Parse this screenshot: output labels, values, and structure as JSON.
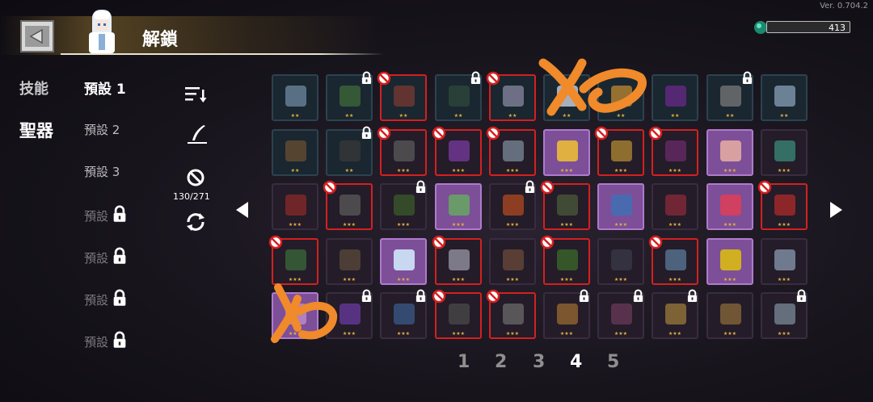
{
  "version": "Ver. 0.704.2",
  "header": {
    "title": "解鎖",
    "currency_amount": "413"
  },
  "tabs": [
    {
      "label": "技能",
      "active": false
    },
    {
      "label": "聖器",
      "active": true
    }
  ],
  "presets": [
    {
      "label": "預設 1",
      "state": "active"
    },
    {
      "label": "預設 2",
      "state": "normal"
    },
    {
      "label": "預設 3",
      "state": "normal"
    },
    {
      "label": "預設",
      "state": "locked"
    },
    {
      "label": "預設",
      "state": "locked"
    },
    {
      "label": "預設",
      "state": "locked"
    },
    {
      "label": "預設",
      "state": "locked"
    }
  ],
  "toolbar": {
    "counter": "130/271",
    "icons": [
      "sort-icon",
      "quill-icon",
      "ban-icon",
      "refresh-icon"
    ]
  },
  "grid": {
    "rows": [
      [
        {
          "tier": "r2",
          "stars": "★★",
          "badge": "",
          "color": "#6f8aa0"
        },
        {
          "tier": "r2",
          "stars": "★★",
          "badge": "lock",
          "color": "#3f6a3a"
        },
        {
          "tier": "r2",
          "stars": "★★",
          "badge": "ban",
          "color": "#7a3a33"
        },
        {
          "tier": "r2",
          "stars": "★★",
          "badge": "lock",
          "color": "#2d4a3a"
        },
        {
          "tier": "r2",
          "stars": "★★",
          "badge": "ban",
          "color": "#8a8aa0"
        },
        {
          "tier": "r2",
          "stars": "★★",
          "badge": "",
          "color": "#d8dde8"
        },
        {
          "tier": "r2",
          "stars": "★★",
          "badge": "",
          "color": "#c08a30"
        },
        {
          "tier": "r2",
          "stars": "★★",
          "badge": "",
          "color": "#6a2a8a"
        },
        {
          "tier": "r2",
          "stars": "★★",
          "badge": "lock",
          "color": "#7a7a78"
        },
        {
          "tier": "r2",
          "stars": "★★",
          "badge": "",
          "color": "#8aa0b8"
        }
      ],
      [
        {
          "tier": "r2",
          "stars": "★★",
          "badge": "",
          "color": "#6a5030"
        },
        {
          "tier": "r2",
          "stars": "★★",
          "badge": "lock",
          "color": "#3a3a3a"
        },
        {
          "tier": "r3",
          "stars": "★★★",
          "badge": "ban",
          "color": "#5a5a5a"
        },
        {
          "tier": "r3",
          "stars": "★★★",
          "badge": "ban",
          "color": "#7a3aa0"
        },
        {
          "tier": "r3",
          "stars": "★★★",
          "badge": "ban",
          "color": "#7a8a9a"
        },
        {
          "tier": "epic",
          "stars": "★★★",
          "badge": "",
          "color": "#e0b040"
        },
        {
          "tier": "r3",
          "stars": "★★★",
          "badge": "ban",
          "color": "#b08a30"
        },
        {
          "tier": "r3",
          "stars": "★★★",
          "badge": "ban",
          "color": "#6a2a6a"
        },
        {
          "tier": "epic",
          "stars": "★★★",
          "badge": "",
          "color": "#d8a0a0"
        },
        {
          "tier": "r3",
          "stars": "★★★",
          "badge": "",
          "color": "#3a8a7a"
        }
      ],
      [
        {
          "tier": "r3",
          "stars": "★★★",
          "badge": "",
          "color": "#8a2a2a"
        },
        {
          "tier": "r3",
          "stars": "★★★",
          "badge": "ban",
          "color": "#5a5a5a"
        },
        {
          "tier": "r3",
          "stars": "★★★",
          "badge": "lock",
          "color": "#3a5a2a"
        },
        {
          "tier": "epic",
          "stars": "★★★",
          "badge": "",
          "color": "#6a9a6a"
        },
        {
          "tier": "r3",
          "stars": "★★★",
          "badge": "lock",
          "color": "#b04a20"
        },
        {
          "tier": "r3",
          "stars": "★★★",
          "badge": "ban",
          "color": "#4a5a3a"
        },
        {
          "tier": "epic",
          "stars": "★★★",
          "badge": "",
          "color": "#4a6ab0"
        },
        {
          "tier": "r3",
          "stars": "★★★",
          "badge": "",
          "color": "#8a2a3a"
        },
        {
          "tier": "epic",
          "stars": "★★★",
          "badge": "",
          "color": "#d04060"
        },
        {
          "tier": "r3",
          "stars": "★★★",
          "badge": "ban",
          "color": "#b02a2a"
        }
      ],
      [
        {
          "tier": "r3",
          "stars": "★★★",
          "badge": "ban",
          "color": "#3a6a3a"
        },
        {
          "tier": "r3",
          "stars": "★★★",
          "badge": "",
          "color": "#5a4a3a"
        },
        {
          "tier": "epic",
          "stars": "★★★",
          "badge": "",
          "color": "#c8d8f0"
        },
        {
          "tier": "r3",
          "stars": "★★★",
          "badge": "ban",
          "color": "#9a9aa8"
        },
        {
          "tier": "r3",
          "stars": "★★★",
          "badge": "",
          "color": "#6a4a3a"
        },
        {
          "tier": "r3",
          "stars": "★★★",
          "badge": "ban",
          "color": "#3a6a2a"
        },
        {
          "tier": "r3",
          "stars": "★★★",
          "badge": "",
          "color": "#3a3a4a"
        },
        {
          "tier": "r3",
          "stars": "★★★",
          "badge": "ban",
          "color": "#5a7a9a"
        },
        {
          "tier": "epic",
          "stars": "★★★",
          "badge": "",
          "color": "#d0b020"
        },
        {
          "tier": "r3",
          "stars": "★★★",
          "badge": "",
          "color": "#8a9ab0"
        }
      ],
      [
        {
          "tier": "epic",
          "stars": "★★★",
          "badge": "",
          "color": "#b080c0"
        },
        {
          "tier": "r3",
          "stars": "★★★",
          "badge": "lock",
          "color": "#6a3aa0"
        },
        {
          "tier": "r3",
          "stars": "★★★",
          "badge": "lock",
          "color": "#3a5a8a"
        },
        {
          "tier": "r3",
          "stars": "★★★",
          "badge": "ban",
          "color": "#4a4a4a"
        },
        {
          "tier": "r3",
          "stars": "★★★",
          "badge": "ban",
          "color": "#6a6a6a"
        },
        {
          "tier": "r3",
          "stars": "★★★",
          "badge": "lock",
          "color": "#9a6a30"
        },
        {
          "tier": "r3",
          "stars": "★★★",
          "badge": "lock",
          "color": "#6a3a5a"
        },
        {
          "tier": "r3",
          "stars": "★★★",
          "badge": "lock",
          "color": "#9a7a3a"
        },
        {
          "tier": "r3",
          "stars": "★★★",
          "badge": "",
          "color": "#8a6a3a"
        },
        {
          "tier": "r3",
          "stars": "★★★",
          "badge": "lock",
          "color": "#7a8a9a"
        }
      ]
    ]
  },
  "pagination": {
    "pages": [
      "1",
      "2",
      "3",
      "4",
      "5"
    ],
    "current": 4
  },
  "colors": {
    "ban": "#d42020",
    "scribble": "#f08a2a",
    "epic": "#7d4f98",
    "gold_bar": "#8c6e2d"
  }
}
